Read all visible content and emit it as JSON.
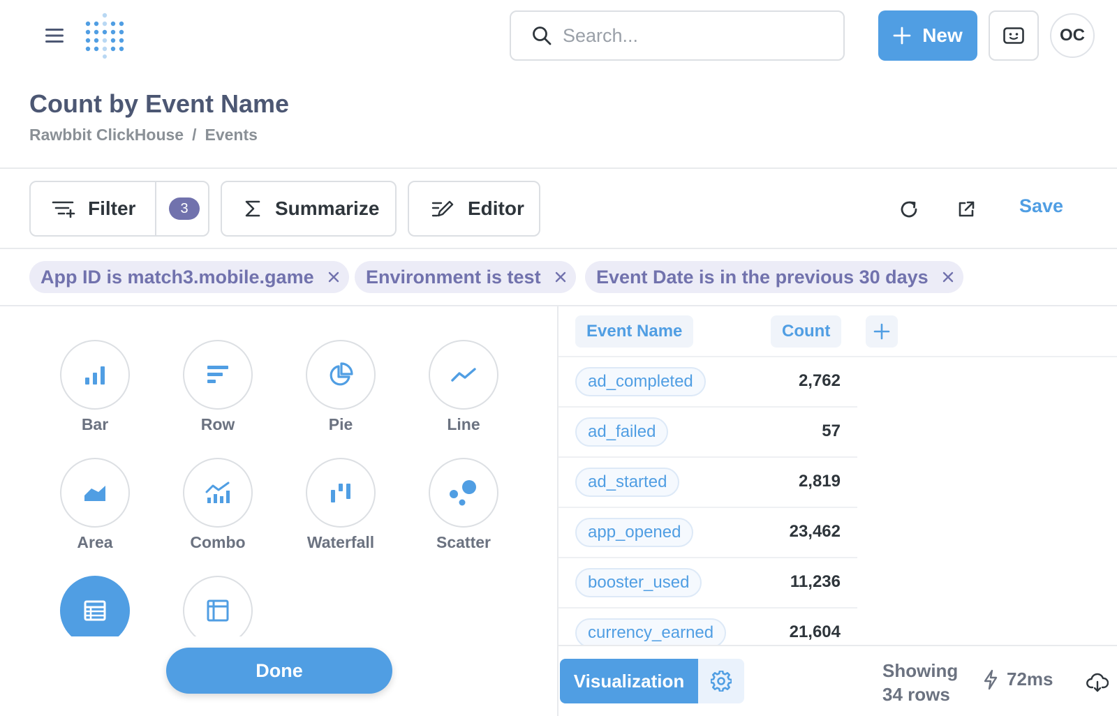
{
  "topbar": {
    "search_placeholder": "Search...",
    "new_label": "New",
    "avatar_initials": "OC"
  },
  "header": {
    "title": "Count by Event Name",
    "breadcrumb": [
      "Rawbbit ClickHouse",
      "Events"
    ],
    "breadcrumb_separator": "/"
  },
  "toolbar": {
    "filter_label": "Filter",
    "filter_count": "3",
    "summarize_label": "Summarize",
    "editor_label": "Editor",
    "save_label": "Save"
  },
  "filters": [
    "App ID is match3.mobile.game",
    "Environment is test",
    "Event Date is in the previous 30 days"
  ],
  "chart_types": [
    {
      "label": "Bar",
      "icon": "bar-chart-icon"
    },
    {
      "label": "Row",
      "icon": "row-chart-icon"
    },
    {
      "label": "Pie",
      "icon": "pie-chart-icon"
    },
    {
      "label": "Line",
      "icon": "line-chart-icon"
    },
    {
      "label": "Area",
      "icon": "area-chart-icon"
    },
    {
      "label": "Combo",
      "icon": "combo-chart-icon"
    },
    {
      "label": "Waterfall",
      "icon": "waterfall-chart-icon"
    },
    {
      "label": "Scatter",
      "icon": "scatter-chart-icon"
    },
    {
      "label": "",
      "icon": "table-icon",
      "selected": true
    },
    {
      "label": "",
      "icon": "pivot-table-icon"
    }
  ],
  "done_label": "Done",
  "table": {
    "columns": [
      "Event Name",
      "Count"
    ],
    "rows": [
      {
        "name": "ad_completed",
        "count": "2,762"
      },
      {
        "name": "ad_failed",
        "count": "57"
      },
      {
        "name": "ad_started",
        "count": "2,819"
      },
      {
        "name": "app_opened",
        "count": "23,462"
      },
      {
        "name": "booster_used",
        "count": "11,236"
      },
      {
        "name": "currency_earned",
        "count": "21,604"
      }
    ]
  },
  "footer": {
    "visualization_label": "Visualization",
    "row_count_line1": "Showing",
    "row_count_line2": "34 rows",
    "timing": "72ms"
  },
  "colors": {
    "brand": "#509ee3",
    "filter_accent": "#7172ad",
    "filter_pill_bg": "#ececf7"
  }
}
